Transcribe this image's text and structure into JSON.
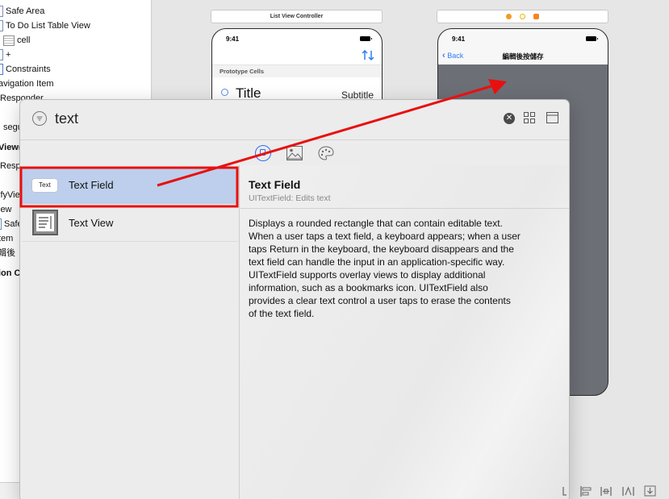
{
  "outline": {
    "items": [
      {
        "label": "Safe Area"
      },
      {
        "label": "To Do List Table View"
      },
      {
        "label": "cell"
      },
      {
        "label": "+"
      },
      {
        "label": "Constraints"
      },
      {
        "label": "avigation Item"
      },
      {
        "label": "Responder"
      },
      {
        "label": "segu"
      },
      {
        "label": "View("
      },
      {
        "label": "Resp"
      },
      {
        "label": "ifyVie"
      },
      {
        "label": "iew"
      },
      {
        "label": "Safe"
      },
      {
        "label": "tem"
      },
      {
        "label": "輯後"
      },
      {
        "label": "ion C"
      }
    ]
  },
  "canvas": {
    "scene1": {
      "title": "List View Controller",
      "time": "9:41",
      "section_header": "Prototype Cells",
      "cell_title": "Title",
      "cell_subtitle": "Subtitle"
    },
    "scene2": {
      "time": "9:41",
      "back_label": "Back",
      "nav_title": "編輯後按儲存",
      "content_color": "#6c6f76"
    }
  },
  "library": {
    "search_value": "text",
    "tabs": [
      "objects-icon",
      "media-icon",
      "colors-icon"
    ],
    "items": [
      {
        "icon_text": "Text",
        "label": "Text Field"
      },
      {
        "label": "Text View"
      }
    ],
    "detail": {
      "title": "Text Field",
      "subtitle": "UITextField: Edits text",
      "lines": [
        "Displays a rounded rectangle that can contain editable text.",
        "When a user taps a text field, a keyboard appears; when a user",
        "taps Return in the keyboard, the keyboard disappears and the",
        "text field can handle the input in an application-specific way.",
        "UITextField supports overlay views to display additional",
        "information, such as a bookmarks icon. UITextField also",
        "provides a clear text control a user taps to erase the contents",
        "of the text field."
      ]
    }
  },
  "colors": {
    "selection": "#bdcfec",
    "annotation_red": "#e8100f",
    "accent_blue": "#2f7cf6"
  }
}
